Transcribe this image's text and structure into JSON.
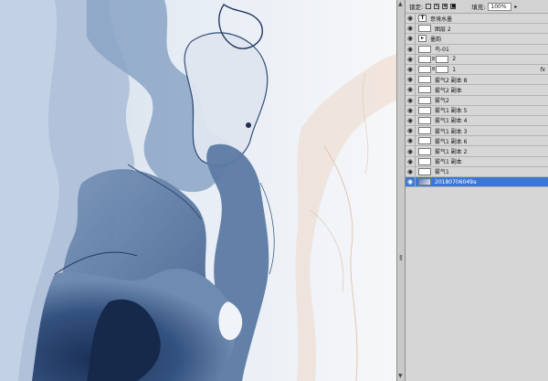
{
  "canvas": {
    "description_icon": "ink-wash-artwork",
    "colors": {
      "ink_dark": "#1f3a63",
      "ink_mid": "#4d6d96",
      "ink_light": "#9bb1cd",
      "paper": "#f2f4f8",
      "peach": "#e9c9b5"
    }
  },
  "layers_panel": {
    "lock_label": "锁定:",
    "fill_label": "填充:",
    "fill_value": "100%",
    "layers": [
      {
        "name": "意境水墨",
        "kind": "text",
        "visible": true,
        "selected": false,
        "fx": ""
      },
      {
        "name": "图层 2",
        "kind": "pixel",
        "visible": true,
        "selected": false,
        "fx": ""
      },
      {
        "name": "墨韵",
        "kind": "group",
        "visible": true,
        "selected": false,
        "fx": ""
      },
      {
        "name": "鸟-01",
        "kind": "pixel",
        "visible": true,
        "selected": false,
        "fx": ""
      },
      {
        "name": "2",
        "kind": "masked",
        "visible": true,
        "selected": false,
        "fx": ""
      },
      {
        "name": "1",
        "kind": "masked",
        "visible": true,
        "selected": false,
        "fx": "fx"
      },
      {
        "name": "雾气2 副本 8",
        "kind": "pixel",
        "visible": true,
        "selected": false,
        "fx": ""
      },
      {
        "name": "雾气2 副本",
        "kind": "pixel",
        "visible": true,
        "selected": false,
        "fx": ""
      },
      {
        "name": "雾气2",
        "kind": "pixel",
        "visible": true,
        "selected": false,
        "fx": ""
      },
      {
        "name": "雾气1 副本 5",
        "kind": "pixel",
        "visible": true,
        "selected": false,
        "fx": ""
      },
      {
        "name": "雾气1 副本 4",
        "kind": "pixel",
        "visible": true,
        "selected": false,
        "fx": ""
      },
      {
        "name": "雾气1 副本 3",
        "kind": "pixel",
        "visible": true,
        "selected": false,
        "fx": ""
      },
      {
        "name": "雾气1 副本 6",
        "kind": "pixel",
        "visible": true,
        "selected": false,
        "fx": ""
      },
      {
        "name": "雾气1 副本 2",
        "kind": "pixel",
        "visible": true,
        "selected": false,
        "fx": ""
      },
      {
        "name": "雾气1 副本",
        "kind": "pixel",
        "visible": true,
        "selected": false,
        "fx": ""
      },
      {
        "name": "雾气1",
        "kind": "pixel",
        "visible": true,
        "selected": false,
        "fx": ""
      },
      {
        "name": "20180706049a",
        "kind": "photo",
        "visible": true,
        "selected": true,
        "fx": ""
      }
    ]
  }
}
